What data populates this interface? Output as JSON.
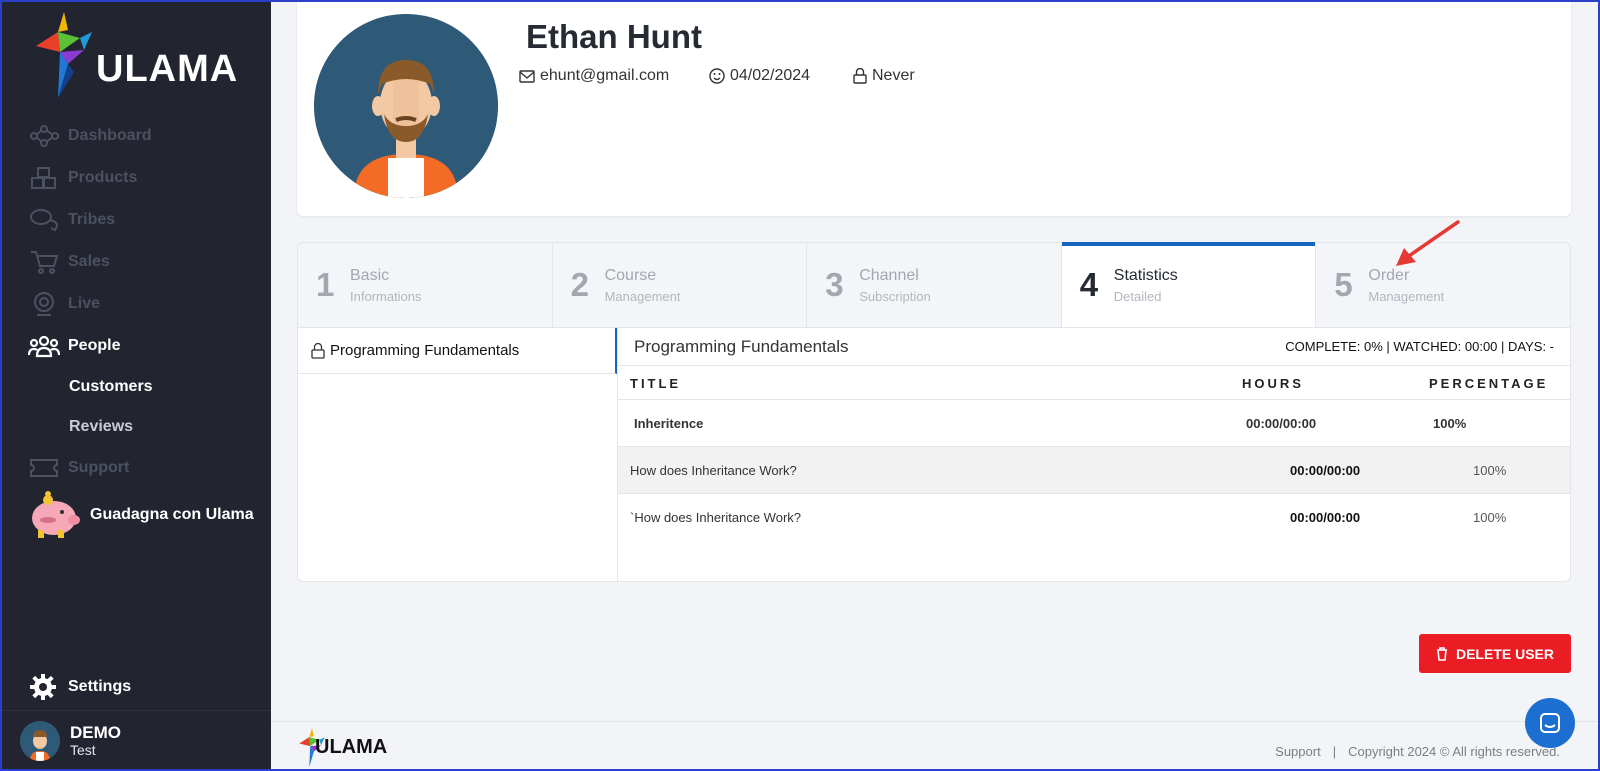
{
  "app": {
    "logo_text": "ULAMA"
  },
  "sidebar": {
    "items": [
      {
        "label": "Dashboard",
        "icon": "network-icon",
        "active": false
      },
      {
        "label": "Products",
        "icon": "boxes-icon",
        "active": false
      },
      {
        "label": "Tribes",
        "icon": "chat-icon",
        "active": false
      },
      {
        "label": "Sales",
        "icon": "cart-icon",
        "active": false
      },
      {
        "label": "Live",
        "icon": "webcam-icon",
        "active": false
      },
      {
        "label": "People",
        "icon": "people-icon",
        "active": true
      }
    ],
    "sub_items": [
      {
        "label": "Customers"
      },
      {
        "label": "Reviews"
      }
    ],
    "support": {
      "label": "Support",
      "icon": "ticket-icon"
    },
    "promo": {
      "label": "Guadagna con Ulama",
      "icon": "piggy-bank-icon"
    },
    "settings": {
      "label": "Settings",
      "icon": "gear-icon"
    },
    "user": {
      "name": "DEMO",
      "sub": "Test"
    }
  },
  "profile": {
    "name": "Ethan Hunt",
    "email": "ehunt@gmail.com",
    "date": "04/02/2024",
    "last_login": "Never"
  },
  "tabs": [
    {
      "num": "1",
      "title": "Basic",
      "subtitle": "Informations",
      "active": false
    },
    {
      "num": "2",
      "title": "Course",
      "subtitle": "Management",
      "active": false
    },
    {
      "num": "3",
      "title": "Channel",
      "subtitle": "Subscription",
      "active": false
    },
    {
      "num": "4",
      "title": "Statistics",
      "subtitle": "Detailed",
      "active": true
    },
    {
      "num": "5",
      "title": "Order",
      "subtitle": "Management",
      "active": false
    }
  ],
  "courses": [
    {
      "title": "Programming Fundamentals"
    }
  ],
  "stats": {
    "title": "Programming Fundamentals",
    "summary": "COMPLETE: 0% | WATCHED: 00:00 | DAYS: -",
    "columns": {
      "title": "TITLE",
      "hours": "HOURS",
      "percentage": "PERCENTAGE"
    },
    "rows": [
      {
        "type": "section",
        "title": "Inheritence",
        "hours": "00:00/00:00",
        "percentage": "100%"
      },
      {
        "type": "lesson",
        "title": "How does Inheritance Work?",
        "hours": "00:00/00:00",
        "percentage": "100%"
      },
      {
        "type": "lesson",
        "title": "`How does Inheritance Work?",
        "hours": "00:00/00:00",
        "percentage": "100%"
      }
    ]
  },
  "actions": {
    "delete_label": "DELETE USER"
  },
  "footer": {
    "logo_text": "ULAMA",
    "support": "Support",
    "separator": "|",
    "copyright": "Copyright 2024 © All rights reserved."
  },
  "colors": {
    "sidebar_bg": "#22252f",
    "accent": "#1565c0",
    "danger": "#ea1c24",
    "chat": "#1c6fd1"
  }
}
